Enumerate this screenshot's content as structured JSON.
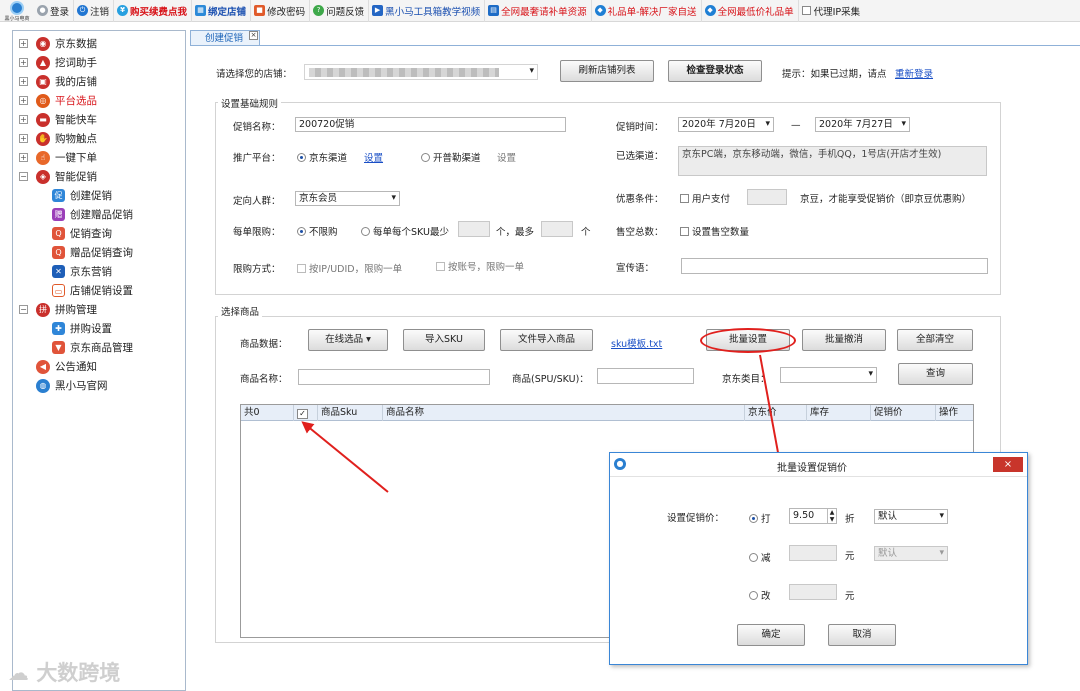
{
  "toolbar": {
    "logo_text": "黑小马电商",
    "items": [
      {
        "label": "登录",
        "icon": "user-icon"
      },
      {
        "label": "注销",
        "icon": "power-icon"
      },
      {
        "label": "购买续费点我",
        "icon": "coin-icon"
      },
      {
        "label": "绑定店铺",
        "icon": "store-icon"
      },
      {
        "label": "修改密码",
        "icon": "lock-icon"
      },
      {
        "label": "问题反馈",
        "icon": "feedback-icon"
      },
      {
        "label": "黑小马工具箱教学视频",
        "icon": "video-icon"
      },
      {
        "label": "全网最奢请补单资源",
        "icon": "doc-icon"
      },
      {
        "label": "礼品单-解决厂家自送",
        "icon": "gift-icon"
      },
      {
        "label": "全网最低价礼品单",
        "icon": "gift-icon"
      },
      {
        "label": "代理IP采集",
        "icon": "checkbox-icon"
      }
    ]
  },
  "sidebar": {
    "items": [
      {
        "label": "京东数据",
        "expanded": false
      },
      {
        "label": "挖词助手",
        "expanded": false
      },
      {
        "label": "我的店铺",
        "expanded": false
      },
      {
        "label": "平台选品",
        "expanded": false,
        "color": "#d8141a"
      },
      {
        "label": "智能快车",
        "expanded": false
      },
      {
        "label": "购物触点",
        "expanded": false
      },
      {
        "label": "一键下单",
        "expanded": false
      },
      {
        "label": "智能促销",
        "expanded": true
      },
      {
        "label": "创建促销"
      },
      {
        "label": "创建赠品促销"
      },
      {
        "label": "促销查询"
      },
      {
        "label": "赠品促销查询"
      },
      {
        "label": "京东营销"
      },
      {
        "label": "店铺促销设置"
      },
      {
        "label": "拼购管理",
        "expanded": true
      },
      {
        "label": "拼购设置"
      },
      {
        "label": "京东商品管理"
      },
      {
        "label": "公告通知"
      },
      {
        "label": "黑小马官网"
      }
    ]
  },
  "tab": {
    "label": "创建促销"
  },
  "store": {
    "label": "请选择您的店铺：",
    "refresh_button": "刷新店铺列表",
    "check_login_button": "检查登录状态",
    "hint": "提示：如果已过期，请点",
    "relogin_link": "重新登录"
  },
  "rules": {
    "title": "设置基础规则",
    "name_label": "促销名称：",
    "name_value": "200720促销",
    "time_label": "促销时间：",
    "start": "2020年 7月20日",
    "dash": "—",
    "end": "2020年 7月27日",
    "platform_label": "推广平台：",
    "jd_channel": "京东渠道",
    "set_link": "设置",
    "kpl_channel": "开普勒渠道",
    "kpl_set": "设置",
    "selected_label": "已选渠道：",
    "selected_value": "京东PC端，京东移动端，微信，手机QQ，1号店(开店才生效)",
    "audience_label": "定向人群：",
    "audience_value": "京东会员",
    "discount_label": "优惠条件：",
    "user_pay": "用户支付",
    "jd_bean_text": "京豆，才能享受促销价（即京豆优惠购）",
    "limit_label": "每单限购：",
    "no_limit": "不限购",
    "per_sku": "每单每个SKU最少",
    "unit1": "个，最多",
    "unit2": "个",
    "sold_label": "售空总数：",
    "sold_value": "设置售空数量",
    "limit_way_label": "限购方式：",
    "by_ip": "按IP/UDID，限购一单",
    "by_account": "按账号，限购一单",
    "slogan_label": "宣传语："
  },
  "products": {
    "title": "选择商品",
    "data_label": "商品数据：",
    "online_button": "在线选品",
    "import_sku_button": "导入SKU",
    "file_import_button": "文件导入商品",
    "template_link": "sku模板.txt",
    "batch_set_button": "批量设置",
    "batch_cancel_button": "批量撤消",
    "clear_all_button": "全部清空",
    "name_label": "商品名称：",
    "spu_label": "商品(SPU/SKU)：",
    "category_label": "京东类目：",
    "query_button": "查询",
    "columns": [
      "共0",
      "✓",
      "商品Sku",
      "商品名称",
      "京东价",
      "库存",
      "促销价",
      "操作"
    ]
  },
  "dialog": {
    "title": "批量设置促销价",
    "price_label": "设置促销价：",
    "opt_discount": "打",
    "discount_value": "9.50",
    "discount_unit": "折",
    "discount_mode": "默认",
    "opt_minus": "减",
    "minus_unit": "元",
    "minus_mode": "默认",
    "opt_change": "改",
    "change_unit": "元",
    "ok": "确定",
    "cancel": "取消"
  },
  "watermark": "大数跨境"
}
